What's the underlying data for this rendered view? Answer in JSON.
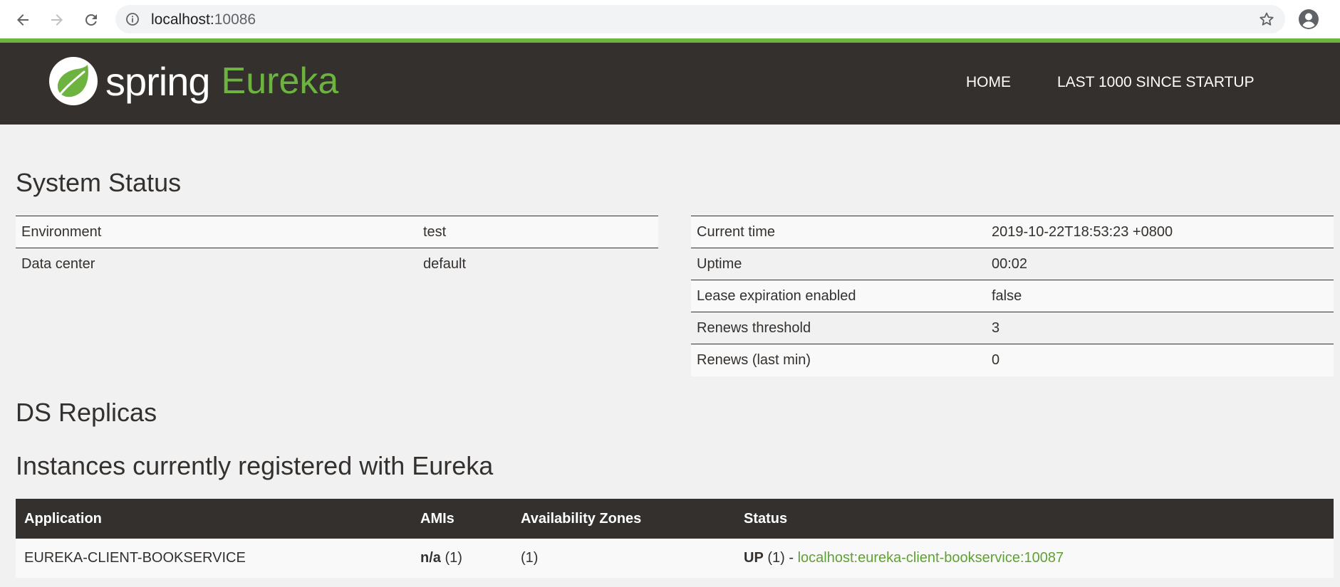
{
  "browser": {
    "url_host": "localhost:",
    "url_port": "10086",
    "icons": [
      "back-icon",
      "forward-icon",
      "reload-icon",
      "info-icon",
      "star-icon",
      "profile-icon"
    ]
  },
  "header": {
    "logo_spring": "spring",
    "logo_eureka": "Eureka",
    "nav": [
      "HOME",
      "LAST 1000 SINCE STARTUP"
    ]
  },
  "colors": {
    "accent": "#6db33f",
    "header_bg": "#34302d",
    "page_bg": "#f1f1f1"
  },
  "system_status": {
    "title": "System Status",
    "left": [
      {
        "key": "Environment",
        "value": "test"
      },
      {
        "key": "Data center",
        "value": "default"
      }
    ],
    "right": [
      {
        "key": "Current time",
        "value": "2019-10-22T18:53:23 +0800"
      },
      {
        "key": "Uptime",
        "value": "00:02"
      },
      {
        "key": "Lease expiration enabled",
        "value": "false"
      },
      {
        "key": "Renews threshold",
        "value": "3"
      },
      {
        "key": "Renews (last min)",
        "value": "0"
      }
    ]
  },
  "ds_replicas": {
    "title": "DS Replicas"
  },
  "instances": {
    "title": "Instances currently registered with Eureka",
    "columns": [
      "Application",
      "AMIs",
      "Availability Zones",
      "Status"
    ],
    "rows": [
      {
        "application": "EUREKA-CLIENT-BOOKSERVICE",
        "amis_bold": "n/a",
        "amis_count": "(1)",
        "zones": "(1)",
        "status_bold": "UP",
        "status_count": "(1) -",
        "status_link": "localhost:eureka-client-bookservice:10087"
      }
    ]
  }
}
